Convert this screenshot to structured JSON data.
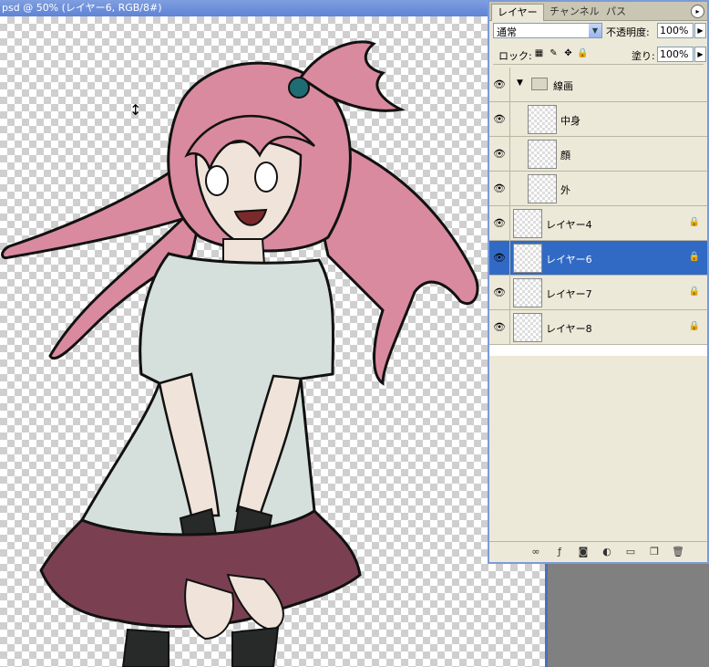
{
  "document": {
    "title": "psd @ 50% (レイヤー6, RGB/8#)"
  },
  "palette": {
    "tabs": [
      "レイヤー",
      "チャンネル",
      "パス"
    ],
    "blend_mode": "通常",
    "opacity_label": "不透明度:",
    "opacity_value": "100%",
    "lock_label": "ロック:",
    "fill_label": "塗り:",
    "fill_value": "100%",
    "layers": [
      {
        "name": "線画",
        "type": "group",
        "selected": false,
        "locked": false
      },
      {
        "name": "中身",
        "type": "child",
        "selected": false,
        "locked": false
      },
      {
        "name": "顔",
        "type": "child",
        "selected": false,
        "locked": false
      },
      {
        "name": "外",
        "type": "child",
        "selected": false,
        "locked": false
      },
      {
        "name": "レイヤー4",
        "type": "layer",
        "selected": false,
        "locked": true
      },
      {
        "name": "レイヤー6",
        "type": "layer",
        "selected": true,
        "locked": true
      },
      {
        "name": "レイヤー7",
        "type": "layer",
        "selected": false,
        "locked": true
      },
      {
        "name": "レイヤー8",
        "type": "layer",
        "selected": false,
        "locked": true
      }
    ]
  },
  "colors": {
    "hair": "#d98a9f",
    "shirt": "#d5e0dc",
    "skin": "#f0e4da",
    "skirt": "#7a4052",
    "sleeves": "#272a28",
    "ornament": "#1f6d73",
    "selection": "#316ac5"
  },
  "icons": [
    "eye-icon",
    "folder-icon",
    "lock-icon",
    "link-icon",
    "fx-icon",
    "mask-icon",
    "adjustment-icon",
    "new-group-icon",
    "new-layer-icon",
    "trash-icon"
  ]
}
